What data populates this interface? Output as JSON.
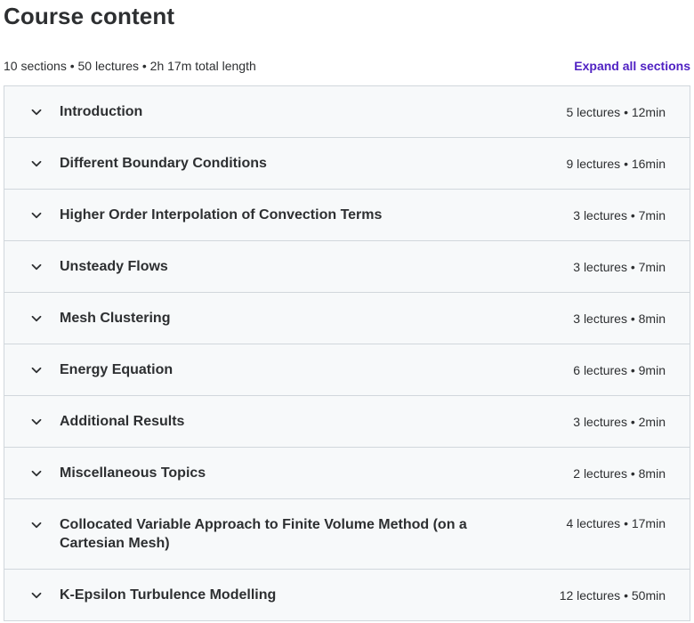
{
  "header": {
    "title": "Course content",
    "summary": "10 sections • 50 lectures • 2h 17m total length",
    "expand_label": "Expand all sections"
  },
  "sections": [
    {
      "title": "Introduction",
      "meta": "5 lectures • 12min"
    },
    {
      "title": "Different Boundary Conditions",
      "meta": "9 lectures • 16min"
    },
    {
      "title": "Higher Order Interpolation of Convection Terms",
      "meta": "3 lectures • 7min"
    },
    {
      "title": "Unsteady Flows",
      "meta": "3 lectures • 7min"
    },
    {
      "title": "Mesh Clustering",
      "meta": "3 lectures • 8min"
    },
    {
      "title": "Energy Equation",
      "meta": "6 lectures • 9min"
    },
    {
      "title": "Additional Results",
      "meta": "3 lectures • 2min"
    },
    {
      "title": "Miscellaneous Topics",
      "meta": "2 lectures • 8min"
    },
    {
      "title": "Collocated Variable Approach to Finite Volume Method (on a Cartesian Mesh)",
      "meta": "4 lectures • 17min"
    },
    {
      "title": "K-Epsilon Turbulence Modelling",
      "meta": "12 lectures • 50min"
    }
  ],
  "icons": {
    "section_toggle": "chevron-down-icon"
  },
  "colors": {
    "accent": "#5022c3",
    "text": "#2d2f31",
    "section_bg": "#f7f9fa",
    "border": "#d1d7dc"
  }
}
